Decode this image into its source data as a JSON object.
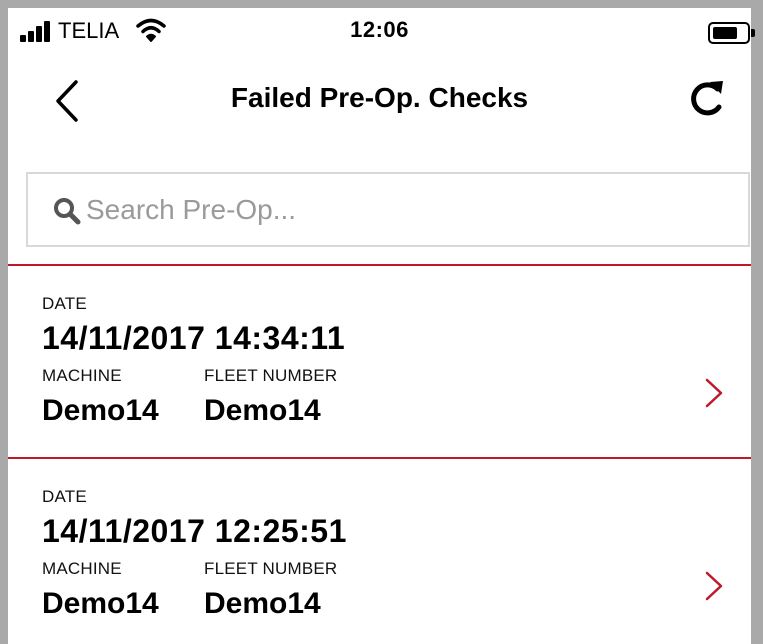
{
  "status_bar": {
    "carrier": "TELIA",
    "time": "12:06",
    "icons": [
      "signal-icon",
      "wifi-icon",
      "battery-icon"
    ]
  },
  "nav": {
    "title": "Failed Pre-Op. Checks",
    "back_icon": "back-chevron-icon",
    "refresh_icon": "refresh-icon"
  },
  "search": {
    "placeholder": "Search Pre-Op...",
    "value": "",
    "icon": "search-icon"
  },
  "labels": {
    "date": "DATE",
    "machine": "MACHINE",
    "fleet_number": "FLEET NUMBER"
  },
  "checks": [
    {
      "date": "14/11/2017 14:34:11",
      "machine": "Demo14",
      "fleet_number": "Demo14"
    },
    {
      "date": "14/11/2017 12:25:51",
      "machine": "Demo14",
      "fleet_number": "Demo14"
    }
  ],
  "colors": {
    "accent": "#c0182b",
    "search_border": "#d8d8d8",
    "placeholder": "#9a9a9a"
  }
}
